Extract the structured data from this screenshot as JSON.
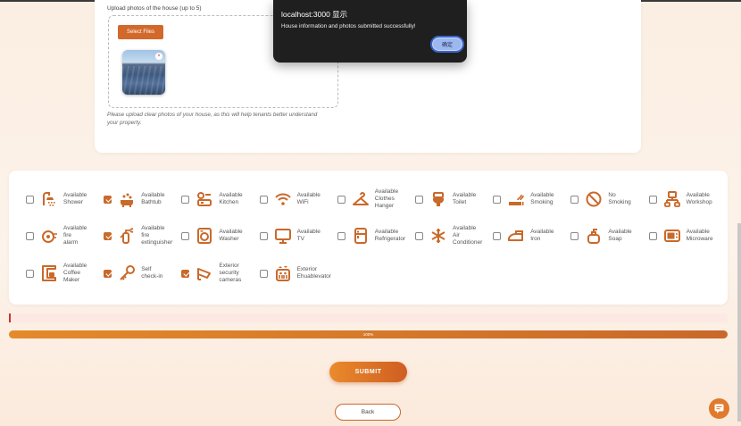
{
  "upload": {
    "label": "Upload photos of the house (up to 5)",
    "select_files": "Select Files",
    "remove_glyph": "×",
    "hint": "Please upload clear photos of your house, as this will help tenants better understand your property."
  },
  "dialog": {
    "title": "localhost:3000 显示",
    "message": "House information and photos submitted successfully!",
    "ok": "确定"
  },
  "amenities": [
    {
      "label": "Available Shower",
      "checked": false,
      "icon": "shower-icon"
    },
    {
      "label": "Available Bathtub",
      "checked": true,
      "icon": "bathtub-icon"
    },
    {
      "label": "Available Kitchen",
      "checked": false,
      "icon": "kitchen-icon"
    },
    {
      "label": "Available WiFi",
      "checked": false,
      "icon": "wifi-icon"
    },
    {
      "label": "Available Clothes Hanger",
      "checked": false,
      "icon": "clothes-hanger-icon"
    },
    {
      "label": "Available Toilet",
      "checked": false,
      "icon": "toilet-icon"
    },
    {
      "label": "Available Smoking",
      "checked": false,
      "icon": "smoking-icon"
    },
    {
      "label": "No Smoking",
      "checked": false,
      "icon": "no-smoking-icon"
    },
    {
      "label": "Available Workshop",
      "checked": false,
      "icon": "workshop-icon"
    },
    {
      "label": "Available fire alarm",
      "checked": false,
      "icon": "fire-alarm-icon"
    },
    {
      "label": "Available fire extinguisher",
      "checked": true,
      "icon": "fire-extinguisher-icon"
    },
    {
      "label": "Available Washer",
      "checked": false,
      "icon": "washer-icon"
    },
    {
      "label": "Available TV",
      "checked": false,
      "icon": "tv-icon"
    },
    {
      "label": "Available Refrigerator",
      "checked": false,
      "icon": "refrigerator-icon"
    },
    {
      "label": "Available Air Conditioner",
      "checked": false,
      "icon": "air-conditioner-icon"
    },
    {
      "label": "Available Iron",
      "checked": false,
      "icon": "iron-icon"
    },
    {
      "label": "Available Soap",
      "checked": false,
      "icon": "soap-icon"
    },
    {
      "label": "Available Microware",
      "checked": false,
      "icon": "microwave-icon"
    },
    {
      "label": "Available Coffee Maker",
      "checked": false,
      "icon": "coffee-maker-icon"
    },
    {
      "label": "Self check-in",
      "checked": true,
      "icon": "self-check-in-icon"
    },
    {
      "label": "Exterior security cameras",
      "checked": true,
      "icon": "security-camera-icon"
    },
    {
      "label": "Exterior Ehuablevator",
      "checked": false,
      "icon": "elevator-icon"
    }
  ],
  "progress": {
    "value": 100,
    "text": "100%"
  },
  "buttons": {
    "submit": "SUBMIT",
    "back": "Back"
  },
  "chat": {
    "icon": "chat-icon"
  },
  "colors": {
    "accent": "#d2682a",
    "error": "#d03030",
    "dialog_bg": "#1f1f1f"
  }
}
